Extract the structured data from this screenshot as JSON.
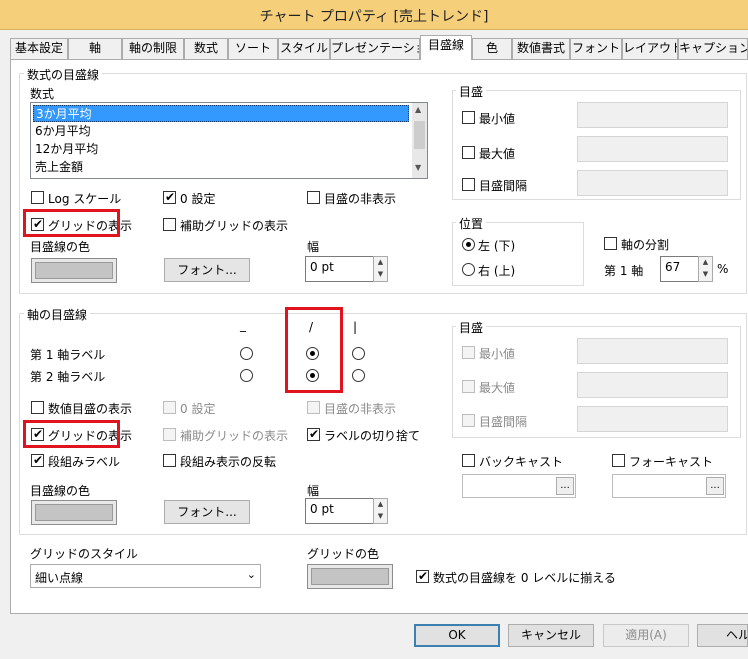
{
  "window": {
    "title": "チャート プロパティ [売上トレンド]"
  },
  "tabs": [
    {
      "label": "基本設定"
    },
    {
      "label": "軸"
    },
    {
      "label": "軸の制限"
    },
    {
      "label": "数式"
    },
    {
      "label": "ソート"
    },
    {
      "label": "スタイル"
    },
    {
      "label": "プレゼンテーション"
    },
    {
      "label": "目盛線"
    },
    {
      "label": "色"
    },
    {
      "label": "数値書式"
    },
    {
      "label": "フォント"
    },
    {
      "label": "レイアウト"
    },
    {
      "label": "キャプション"
    }
  ],
  "active_tab": "目盛線",
  "expr_grid": {
    "group_label": "数式の目盛線",
    "expr_label": "数式",
    "expressions": [
      "3か月平均",
      "6か月平均",
      "12か月平均",
      "売上金額"
    ],
    "selected_expression": "3か月平均",
    "log_scale": {
      "label": "Log スケール",
      "checked": false
    },
    "zero_setting": {
      "label": "0 設定",
      "checked": true
    },
    "hide_scale": {
      "label": "目盛の非表示",
      "checked": false
    },
    "show_grid": {
      "label": "グリッドの表示",
      "checked": true
    },
    "show_minor_grid": {
      "label": "補助グリッドの表示",
      "checked": false
    },
    "color_label": "目盛線の色",
    "font_button": "フォント...",
    "width_label": "幅",
    "width_value": "0 pt",
    "scale": {
      "group_label": "目盛",
      "min_label": "最小値",
      "max_label": "最大値",
      "interval_label": "目盛間隔"
    },
    "position": {
      "group_label": "位置",
      "left_label": "左 (下)",
      "left_selected": true,
      "right_label": "右 (上)",
      "right_selected": false
    },
    "axis_split": {
      "label": "軸の分割",
      "checked": false
    },
    "first_axis_label": "第 1 軸",
    "first_axis_value": "67",
    "percent_label": "%"
  },
  "dim_grid": {
    "group_label": "軸の目盛線",
    "orientation_headers": [
      "_",
      "/",
      "|"
    ],
    "rows": [
      {
        "label": "第 1 軸ラベル",
        "selected": "/"
      },
      {
        "label": "第 2 軸ラベル",
        "selected": "/"
      }
    ],
    "show_numeric_scale": {
      "label": "数値目盛の表示",
      "checked": false
    },
    "zero_setting": {
      "label": "0 設定",
      "checked": false
    },
    "hide_scale": {
      "label": "目盛の非表示",
      "checked": false
    },
    "show_grid": {
      "label": "グリッドの表示",
      "checked": true
    },
    "show_minor_grid": {
      "label": "補助グリッドの表示",
      "checked": false
    },
    "truncate_labels": {
      "label": "ラベルの切り捨て",
      "checked": true
    },
    "stagger_labels": {
      "label": "段組みラベル",
      "checked": true
    },
    "reverse_stagger": {
      "label": "段組み表示の反転",
      "checked": false
    },
    "color_label": "目盛線の色",
    "font_button": "フォント...",
    "width_label": "幅",
    "width_value": "0 pt",
    "scale": {
      "group_label": "目盛",
      "min_label": "最小値",
      "max_label": "最大値",
      "interval_label": "目盛間隔"
    },
    "backcast": {
      "label": "バックキャスト",
      "checked": false
    },
    "forecast": {
      "label": "フォーキャスト",
      "checked": false
    },
    "dots_button": "..."
  },
  "bottom": {
    "grid_style_label": "グリッドのスタイル",
    "grid_style_value": "細い点線",
    "grid_color_label": "グリッドの色",
    "align_zero": {
      "label": "数式の目盛線を 0 レベルに揃える",
      "checked": true
    }
  },
  "footer": {
    "ok": "OK",
    "cancel": "キャンセル",
    "apply": "適用(A)",
    "help": "ヘルプ"
  },
  "colors": {
    "titlebar": "#f5cf7a",
    "highlight_box": "#e0141e",
    "selection": "#3399ff"
  }
}
